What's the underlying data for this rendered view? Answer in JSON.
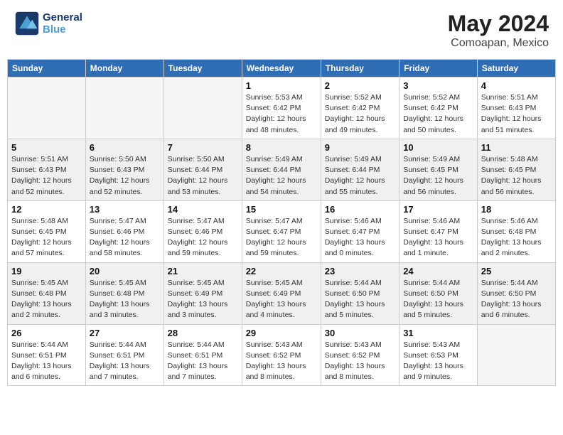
{
  "header": {
    "logo_line1": "General",
    "logo_line2": "Blue",
    "month_year": "May 2024",
    "location": "Comoapan, Mexico"
  },
  "days_of_week": [
    "Sunday",
    "Monday",
    "Tuesday",
    "Wednesday",
    "Thursday",
    "Friday",
    "Saturday"
  ],
  "weeks": [
    [
      {
        "day": "",
        "info": ""
      },
      {
        "day": "",
        "info": ""
      },
      {
        "day": "",
        "info": ""
      },
      {
        "day": "1",
        "info": "Sunrise: 5:53 AM\nSunset: 6:42 PM\nDaylight: 12 hours\nand 48 minutes."
      },
      {
        "day": "2",
        "info": "Sunrise: 5:52 AM\nSunset: 6:42 PM\nDaylight: 12 hours\nand 49 minutes."
      },
      {
        "day": "3",
        "info": "Sunrise: 5:52 AM\nSunset: 6:42 PM\nDaylight: 12 hours\nand 50 minutes."
      },
      {
        "day": "4",
        "info": "Sunrise: 5:51 AM\nSunset: 6:43 PM\nDaylight: 12 hours\nand 51 minutes."
      }
    ],
    [
      {
        "day": "5",
        "info": "Sunrise: 5:51 AM\nSunset: 6:43 PM\nDaylight: 12 hours\nand 52 minutes."
      },
      {
        "day": "6",
        "info": "Sunrise: 5:50 AM\nSunset: 6:43 PM\nDaylight: 12 hours\nand 52 minutes."
      },
      {
        "day": "7",
        "info": "Sunrise: 5:50 AM\nSunset: 6:44 PM\nDaylight: 12 hours\nand 53 minutes."
      },
      {
        "day": "8",
        "info": "Sunrise: 5:49 AM\nSunset: 6:44 PM\nDaylight: 12 hours\nand 54 minutes."
      },
      {
        "day": "9",
        "info": "Sunrise: 5:49 AM\nSunset: 6:44 PM\nDaylight: 12 hours\nand 55 minutes."
      },
      {
        "day": "10",
        "info": "Sunrise: 5:49 AM\nSunset: 6:45 PM\nDaylight: 12 hours\nand 56 minutes."
      },
      {
        "day": "11",
        "info": "Sunrise: 5:48 AM\nSunset: 6:45 PM\nDaylight: 12 hours\nand 56 minutes."
      }
    ],
    [
      {
        "day": "12",
        "info": "Sunrise: 5:48 AM\nSunset: 6:45 PM\nDaylight: 12 hours\nand 57 minutes."
      },
      {
        "day": "13",
        "info": "Sunrise: 5:47 AM\nSunset: 6:46 PM\nDaylight: 12 hours\nand 58 minutes."
      },
      {
        "day": "14",
        "info": "Sunrise: 5:47 AM\nSunset: 6:46 PM\nDaylight: 12 hours\nand 59 minutes."
      },
      {
        "day": "15",
        "info": "Sunrise: 5:47 AM\nSunset: 6:47 PM\nDaylight: 12 hours\nand 59 minutes."
      },
      {
        "day": "16",
        "info": "Sunrise: 5:46 AM\nSunset: 6:47 PM\nDaylight: 13 hours\nand 0 minutes."
      },
      {
        "day": "17",
        "info": "Sunrise: 5:46 AM\nSunset: 6:47 PM\nDaylight: 13 hours\nand 1 minute."
      },
      {
        "day": "18",
        "info": "Sunrise: 5:46 AM\nSunset: 6:48 PM\nDaylight: 13 hours\nand 2 minutes."
      }
    ],
    [
      {
        "day": "19",
        "info": "Sunrise: 5:45 AM\nSunset: 6:48 PM\nDaylight: 13 hours\nand 2 minutes."
      },
      {
        "day": "20",
        "info": "Sunrise: 5:45 AM\nSunset: 6:48 PM\nDaylight: 13 hours\nand 3 minutes."
      },
      {
        "day": "21",
        "info": "Sunrise: 5:45 AM\nSunset: 6:49 PM\nDaylight: 13 hours\nand 3 minutes."
      },
      {
        "day": "22",
        "info": "Sunrise: 5:45 AM\nSunset: 6:49 PM\nDaylight: 13 hours\nand 4 minutes."
      },
      {
        "day": "23",
        "info": "Sunrise: 5:44 AM\nSunset: 6:50 PM\nDaylight: 13 hours\nand 5 minutes."
      },
      {
        "day": "24",
        "info": "Sunrise: 5:44 AM\nSunset: 6:50 PM\nDaylight: 13 hours\nand 5 minutes."
      },
      {
        "day": "25",
        "info": "Sunrise: 5:44 AM\nSunset: 6:50 PM\nDaylight: 13 hours\nand 6 minutes."
      }
    ],
    [
      {
        "day": "26",
        "info": "Sunrise: 5:44 AM\nSunset: 6:51 PM\nDaylight: 13 hours\nand 6 minutes."
      },
      {
        "day": "27",
        "info": "Sunrise: 5:44 AM\nSunset: 6:51 PM\nDaylight: 13 hours\nand 7 minutes."
      },
      {
        "day": "28",
        "info": "Sunrise: 5:44 AM\nSunset: 6:51 PM\nDaylight: 13 hours\nand 7 minutes."
      },
      {
        "day": "29",
        "info": "Sunrise: 5:43 AM\nSunset: 6:52 PM\nDaylight: 13 hours\nand 8 minutes."
      },
      {
        "day": "30",
        "info": "Sunrise: 5:43 AM\nSunset: 6:52 PM\nDaylight: 13 hours\nand 8 minutes."
      },
      {
        "day": "31",
        "info": "Sunrise: 5:43 AM\nSunset: 6:53 PM\nDaylight: 13 hours\nand 9 minutes."
      },
      {
        "day": "",
        "info": ""
      }
    ]
  ]
}
